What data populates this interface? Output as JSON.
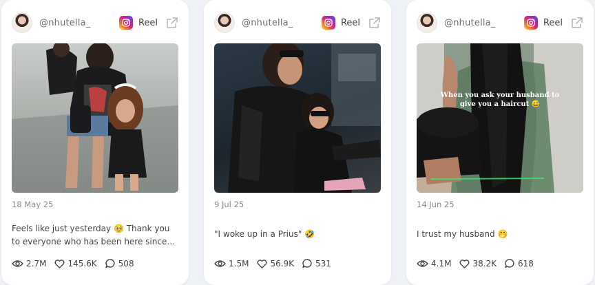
{
  "posts": [
    {
      "handle": "@nhutella_",
      "reel_label": "Reel",
      "date": "18 May 25",
      "caption": "Feels like just yesterday 🥹 Thank you to everyone who has been here since the...",
      "views": "2.7M",
      "likes": "145.6K",
      "comments": "508",
      "image": "mother-and-daughter-leather-jackets-outdoor"
    },
    {
      "handle": "@nhutella_",
      "reel_label": "Reel",
      "date": "9 Jul 25",
      "caption": "\"I woke up in a Prius\" 🤣",
      "views": "1.5M",
      "likes": "56.9K",
      "comments": "531",
      "image": "mother-and-daughter-sunglasses-kitchen"
    },
    {
      "handle": "@nhutella_",
      "reel_label": "Reel",
      "date": "14 Jun 25",
      "caption": "I trust my husband 🤭",
      "views": "4.1M",
      "likes": "38.2K",
      "comments": "618",
      "image": "woman-long-hair-haircut",
      "overlay_text": "When you ask your husband to give you a haircut 😅"
    }
  ],
  "colors": {
    "accent_brand": "#d62976",
    "text": "#444444",
    "muted": "#8a8a8a"
  }
}
